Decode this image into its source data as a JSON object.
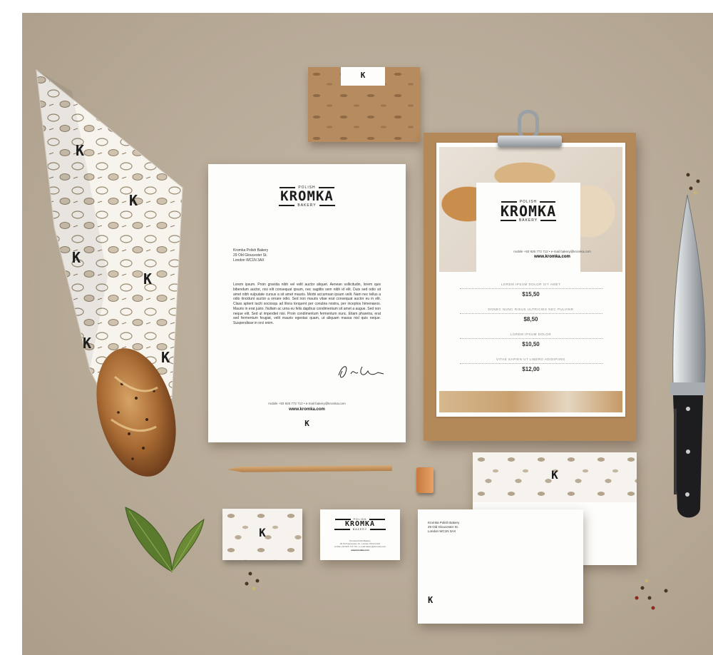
{
  "brand": {
    "top": "POLISH",
    "name": "KROMKA",
    "bottom": "BAKERY",
    "monogram": "K"
  },
  "letterhead": {
    "address": [
      "Kromka Polish Bakery",
      "29 Old Gloucester St.",
      "London WC1N 3AX"
    ],
    "body": "Lorem ipsum. Proin gravida nibh vel velit auctor aliquet. Aenean sollicitudin, lorem quis bibendum auctor, nisi elit consequat ipsum, nec sagittis sem nibh id elit. Duis sed odio sit amet nibh vulputate cursus a sit amet mauris. Morbi accumsan ipsum velit. Nam nec tellus a odio tincidunt auctor a ornare odio. Sed non mauris vitae erat consequat auctor eu in elit. Class aptent taciti sociosqu ad litora torquent per conubia nostra, per inceptos himenaeos. Mauris in erat justo. Nullam ac urna eu felis dapibus condimentum sit amet a augue. Sed non neque elit. Sed ut imperdiet nisi. Proin condimentum fermentum nunc. Etiam pharetra, erat sed fermentum feugiat, velit mauris egestas quam, ut aliquam massa nisl quis neque. Suspendisse in orci enim.",
    "contact": "mobile +93 926 772 712   •   e-mail bakery@kromka.com",
    "website": "www.kromka.com"
  },
  "menu": {
    "contact": "mobile +93 926 772 712   •   e-mail bakery@kromka.com",
    "website": "www.kromka.com",
    "items": [
      {
        "name": "LOREM IPSUM DOLOR SIT AMET",
        "price": "$15,50"
      },
      {
        "name": "DONEC NUNC RISUS ULTRICIES NEC PULVINR",
        "price": "$8,50"
      },
      {
        "name": "LOREM IPSUM DOLOR",
        "price": "$10,50"
      },
      {
        "name": "VITAE SAPIEN UT LIBERO ADIDIPIING",
        "price": "$12,00"
      }
    ]
  },
  "business_card": {
    "lines": [
      "Kromka Polish Bakery",
      "29 Old Gloucester St., London WC1N 3AX"
    ],
    "contact": "mobile +93 926 772 712   •   e-mail bakery@kromka.com",
    "website": "www.kromka.com"
  },
  "envelope": {
    "address": [
      "Kromka Polish Bakery",
      "29 Old Gloucester St.",
      "London WC1N 3AX"
    ]
  },
  "colors": {
    "background": "#b9ad9b",
    "kraft": "#b48a5c",
    "ink": "#1c1c1c"
  }
}
